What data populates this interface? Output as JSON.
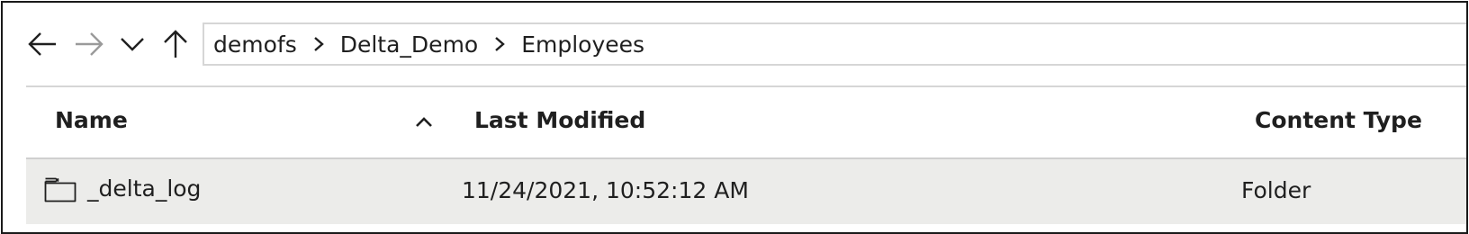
{
  "navigation": {
    "back_icon": "arrow-left-icon",
    "forward_icon": "arrow-right-icon",
    "recent_icon": "chevron-down-icon",
    "up_icon": "arrow-up-icon"
  },
  "breadcrumb": [
    {
      "label": "demofs"
    },
    {
      "label": "Delta_Demo"
    },
    {
      "label": "Employees"
    }
  ],
  "table": {
    "columns": [
      "Name",
      "Last Modified",
      "Content Type"
    ],
    "sort": {
      "column": "Name",
      "direction": "ascending"
    },
    "rows": [
      {
        "icon": "folder-icon",
        "name": "_delta_log",
        "last_modified": "11/24/2021, 10:52:12 AM",
        "content_type": "Folder",
        "selected": true
      }
    ]
  },
  "colors": {
    "selected_row": "#ececea",
    "border": "#d6d6d6",
    "disabled_icon": "#9a9a9a"
  }
}
